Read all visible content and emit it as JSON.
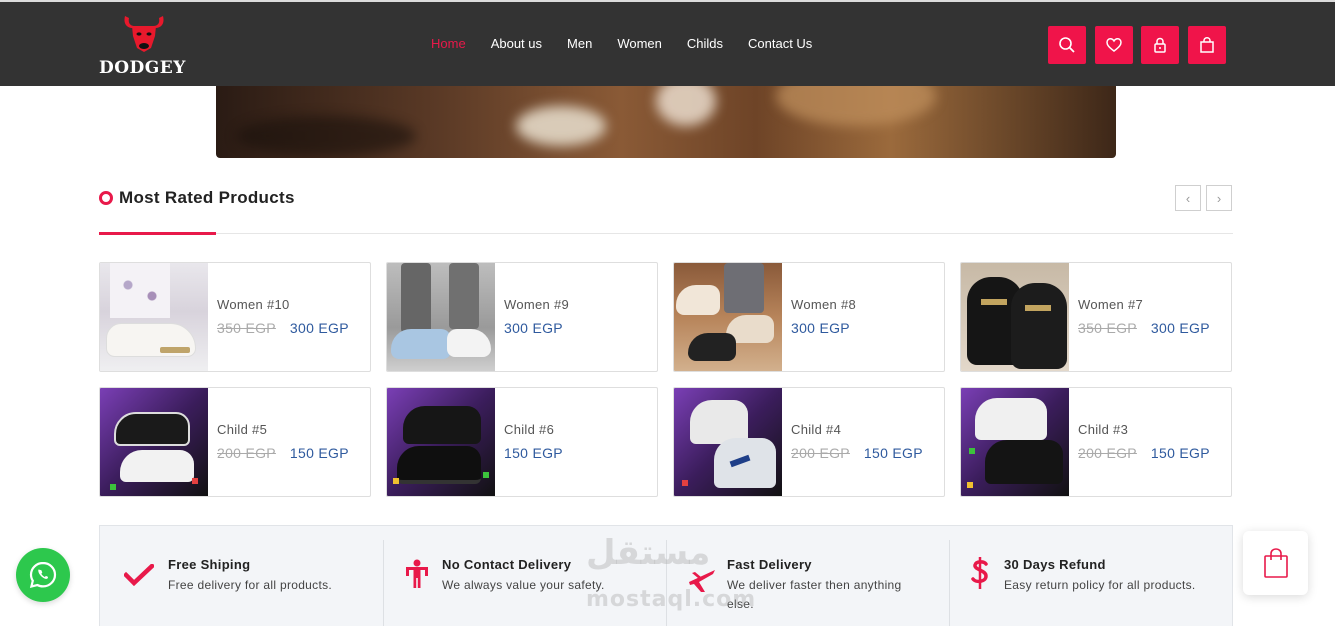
{
  "brand": {
    "name": "DODGEY"
  },
  "nav": {
    "items": [
      {
        "label": "Home",
        "active": true
      },
      {
        "label": "About us"
      },
      {
        "label": "Men"
      },
      {
        "label": "Women"
      },
      {
        "label": "Childs"
      },
      {
        "label": "Contact Us"
      }
    ]
  },
  "header_icons": [
    "search-icon",
    "heart-icon",
    "lock-icon",
    "shopping-bag-icon"
  ],
  "section": {
    "title": "Most Rated Products"
  },
  "products": [
    {
      "name": "Women #10",
      "old_price": "350 EGP",
      "price": "300 EGP"
    },
    {
      "name": "Women #9",
      "old_price": "",
      "price": "300 EGP"
    },
    {
      "name": "Women #8",
      "old_price": "",
      "price": "300 EGP"
    },
    {
      "name": "Women #7",
      "old_price": "350 EGP",
      "price": "300 EGP"
    },
    {
      "name": "Child #5",
      "old_price": "200 EGP",
      "price": "150 EGP"
    },
    {
      "name": "Child #6",
      "old_price": "",
      "price": "150 EGP"
    },
    {
      "name": "Child #4",
      "old_price": "200 EGP",
      "price": "150 EGP"
    },
    {
      "name": "Child #3",
      "old_price": "200 EGP",
      "price": "150 EGP"
    }
  ],
  "features": [
    {
      "title": "Free Shiping",
      "desc": "Free delivery for all products.",
      "icon": "check-icon"
    },
    {
      "title": "No Contact Delivery",
      "desc": "We always value your safety.",
      "icon": "person-icon"
    },
    {
      "title": "Fast Delivery",
      "desc": "We deliver faster then anything else.",
      "icon": "plane-icon"
    },
    {
      "title": "30 Days Refund",
      "desc": "Easy return policy for all products.",
      "icon": "dollar-icon"
    }
  ],
  "watermark": {
    "arabic": "مستقل",
    "latin": "mostaql.com"
  },
  "colors": {
    "accent": "#e8194a",
    "header_bg": "#333333",
    "price": "#2f5a9e",
    "whatsapp": "#2dc84d"
  }
}
